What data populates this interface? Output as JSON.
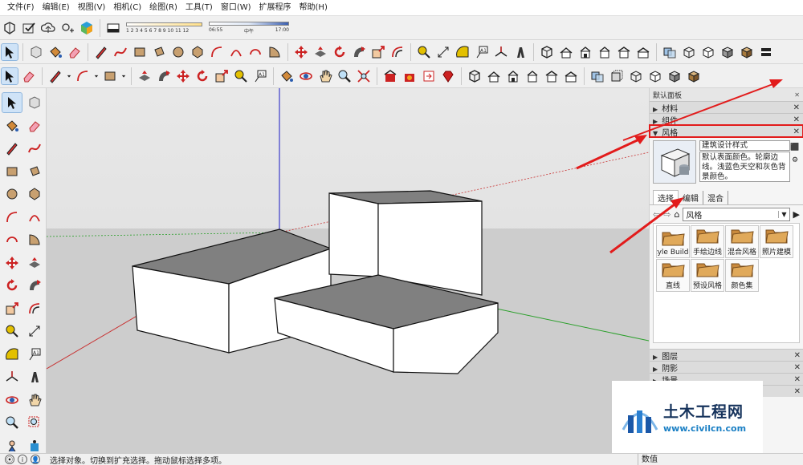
{
  "menubar": {
    "items": [
      "文件(F)",
      "编辑(E)",
      "视图(V)",
      "相机(C)",
      "绘图(R)",
      "工具(T)",
      "窗口(W)",
      "扩展程序",
      "帮助(H)"
    ]
  },
  "toolbar": {
    "shadow_months": "1 2 3 4 5 6 7 8 9 10 11 12",
    "time_start": "06:55",
    "time_mid": "中午",
    "time_end": "17:00",
    "row1_icons": [
      "model-info-icon",
      "check-icon",
      "upload-icon",
      "add-location-icon",
      "extension-icon",
      "eraser-box-icon"
    ],
    "row2_icons": [
      "select-icon",
      "component-icon",
      "paint-bucket-icon",
      "eraser-icon",
      "pencil-icon",
      "freehand-icon",
      "rectangle-icon",
      "rotated-rect-icon",
      "circle-icon",
      "polygon-icon",
      "arc-icon",
      "arc2-icon",
      "arc3-icon",
      "pie-icon",
      "move-icon",
      "push-pull-icon",
      "rotate-icon",
      "follow-me-icon",
      "scale-icon",
      "offset-icon",
      "tape-icon",
      "dimension-icon",
      "protractor-icon",
      "text-icon",
      "axes-icon",
      "3d-text-icon",
      "iso-icon",
      "top-icon",
      "front-icon",
      "right-icon",
      "back-icon",
      "left-icon",
      "style-xray-icon",
      "wireframe-icon",
      "hidden-line-icon",
      "shaded-icon",
      "textured-icon",
      "monochrome-icon"
    ],
    "row3_icons": [
      "select-icon",
      "eraser-icon",
      "line-icon",
      "dropdown-icon",
      "arc-icon",
      "dropdown-icon",
      "shape-icon",
      "dropdown-icon",
      "push-pull-icon",
      "follow-me-icon",
      "move-icon",
      "rotate-icon",
      "scale-icon",
      "tape-icon",
      "text-icon",
      "paint-bucket-icon",
      "orbit-icon",
      "pan-icon",
      "zoom-icon",
      "zoom-extents-icon",
      "warehouse-icon",
      "extension-warehouse-icon",
      "send-layout-icon",
      "ruby-icon",
      "iso-icon",
      "top-icon",
      "front-icon",
      "right-icon",
      "back-icon",
      "left-icon",
      "xray-icon",
      "back-edges-icon",
      "wireframe-icon",
      "hidden-line-icon",
      "shaded-icon",
      "textured-icon"
    ]
  },
  "lefttoolbar": {
    "icons": [
      "select-icon",
      "component-icon",
      "paint-bucket-icon",
      "eraser-icon",
      "line-icon",
      "freehand-icon",
      "rectangle-icon",
      "rotated-rect-icon",
      "circle-icon",
      "polygon-icon",
      "arc-icon",
      "arc2-icon",
      "arc3-icon",
      "pie-icon",
      "move-icon",
      "push-pull-icon",
      "rotate-icon",
      "follow-me-icon",
      "scale-icon",
      "offset-icon",
      "tape-icon",
      "dimension-icon",
      "protractor-icon",
      "text-icon",
      "axes-icon",
      "3d-text-icon",
      "orbit-icon",
      "pan-icon",
      "zoom-icon",
      "zoom-window-icon",
      "position-camera-icon",
      "walk-icon"
    ]
  },
  "tray": {
    "title": "默认面板",
    "panels_top": [
      {
        "label": "材料"
      },
      {
        "label": "组件"
      }
    ],
    "style_panel": {
      "label": "风格",
      "style_name": "建筑设计样式",
      "style_description": "默认表面颜色。轮廓边线。浅蓝色天空和灰色背景颜色。",
      "tabs": [
        "选择",
        "编辑",
        "混合"
      ],
      "active_tab": "选择",
      "collection": "风格",
      "items": [
        "Style Builder",
        "手绘边线",
        "混合风格",
        "照片建模",
        "直线",
        "预设风格",
        "颜色集"
      ]
    },
    "panels_bottom": [
      {
        "label": "图层"
      },
      {
        "label": "阴影"
      },
      {
        "label": "场景"
      },
      {
        "label": ""
      }
    ]
  },
  "statusbar": {
    "message": "选择对象。切换到扩充选择。拖动鼠标选择多项。",
    "measure_label": "数值"
  },
  "watermark": {
    "title": "土木工程网",
    "url": "www.civilcn.com"
  },
  "colors": {
    "highlight_red": "#e21b1b",
    "sky_gray": "#d9d9d9",
    "ground_gray": "#c9c9c9",
    "accent_blue": "#1a7fc4"
  }
}
